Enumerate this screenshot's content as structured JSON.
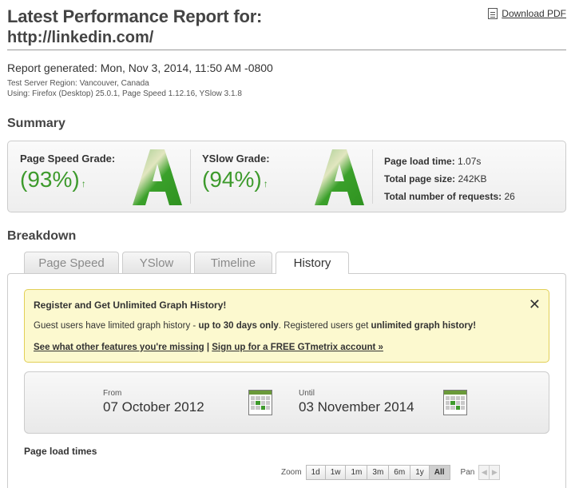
{
  "header": {
    "title": "Latest Performance Report for:",
    "url": "http://linkedin.com/",
    "download_pdf": "Download PDF"
  },
  "meta": {
    "generated": "Report generated: Mon, Nov 3, 2014, 11:50 AM -0800",
    "region": "Test Server Region: Vancouver, Canada",
    "using": "Using: Firefox (Desktop) 25.0.1, Page Speed 1.12.16, YSlow 3.1.8"
  },
  "summary": {
    "heading": "Summary",
    "pagespeed": {
      "label": "Page Speed Grade:",
      "percent": "(93%)",
      "grade": "A"
    },
    "yslow": {
      "label": "YSlow Grade:",
      "percent": "(94%)",
      "grade": "A"
    },
    "stats": {
      "load_time_label": "Page load time:",
      "load_time_value": "1.07s",
      "page_size_label": "Total page size:",
      "page_size_value": "242KB",
      "requests_label": "Total number of requests:",
      "requests_value": "26"
    }
  },
  "breakdown": {
    "heading": "Breakdown",
    "tabs": [
      "Page Speed",
      "YSlow",
      "Timeline",
      "History"
    ],
    "active_tab": "History"
  },
  "notice": {
    "title": "Register and Get Unlimited Graph History!",
    "close": "✕",
    "body_pre": "Guest users have limited graph history - ",
    "body_bold1": "up to 30 days only",
    "body_mid": ". Registered users get ",
    "body_bold2": "unlimited graph history!",
    "link1": "See what other features you're missing",
    "separator": " | ",
    "link2": "Sign up for a FREE GTmetrix account »"
  },
  "daterange": {
    "from_label": "From",
    "from_value": "07 October 2012",
    "until_label": "Until",
    "until_value": "03 November 2014"
  },
  "graph": {
    "title": "Page load times",
    "zoom_label": "Zoom",
    "zoom_options": [
      "1d",
      "1w",
      "1m",
      "3m",
      "6m",
      "1y",
      "All"
    ],
    "zoom_selected": "All",
    "pan_label": "Pan"
  },
  "colors": {
    "grade_green": "#3d9a2c",
    "notice_bg": "#fcf9cf",
    "notice_border": "#e2cf57"
  }
}
